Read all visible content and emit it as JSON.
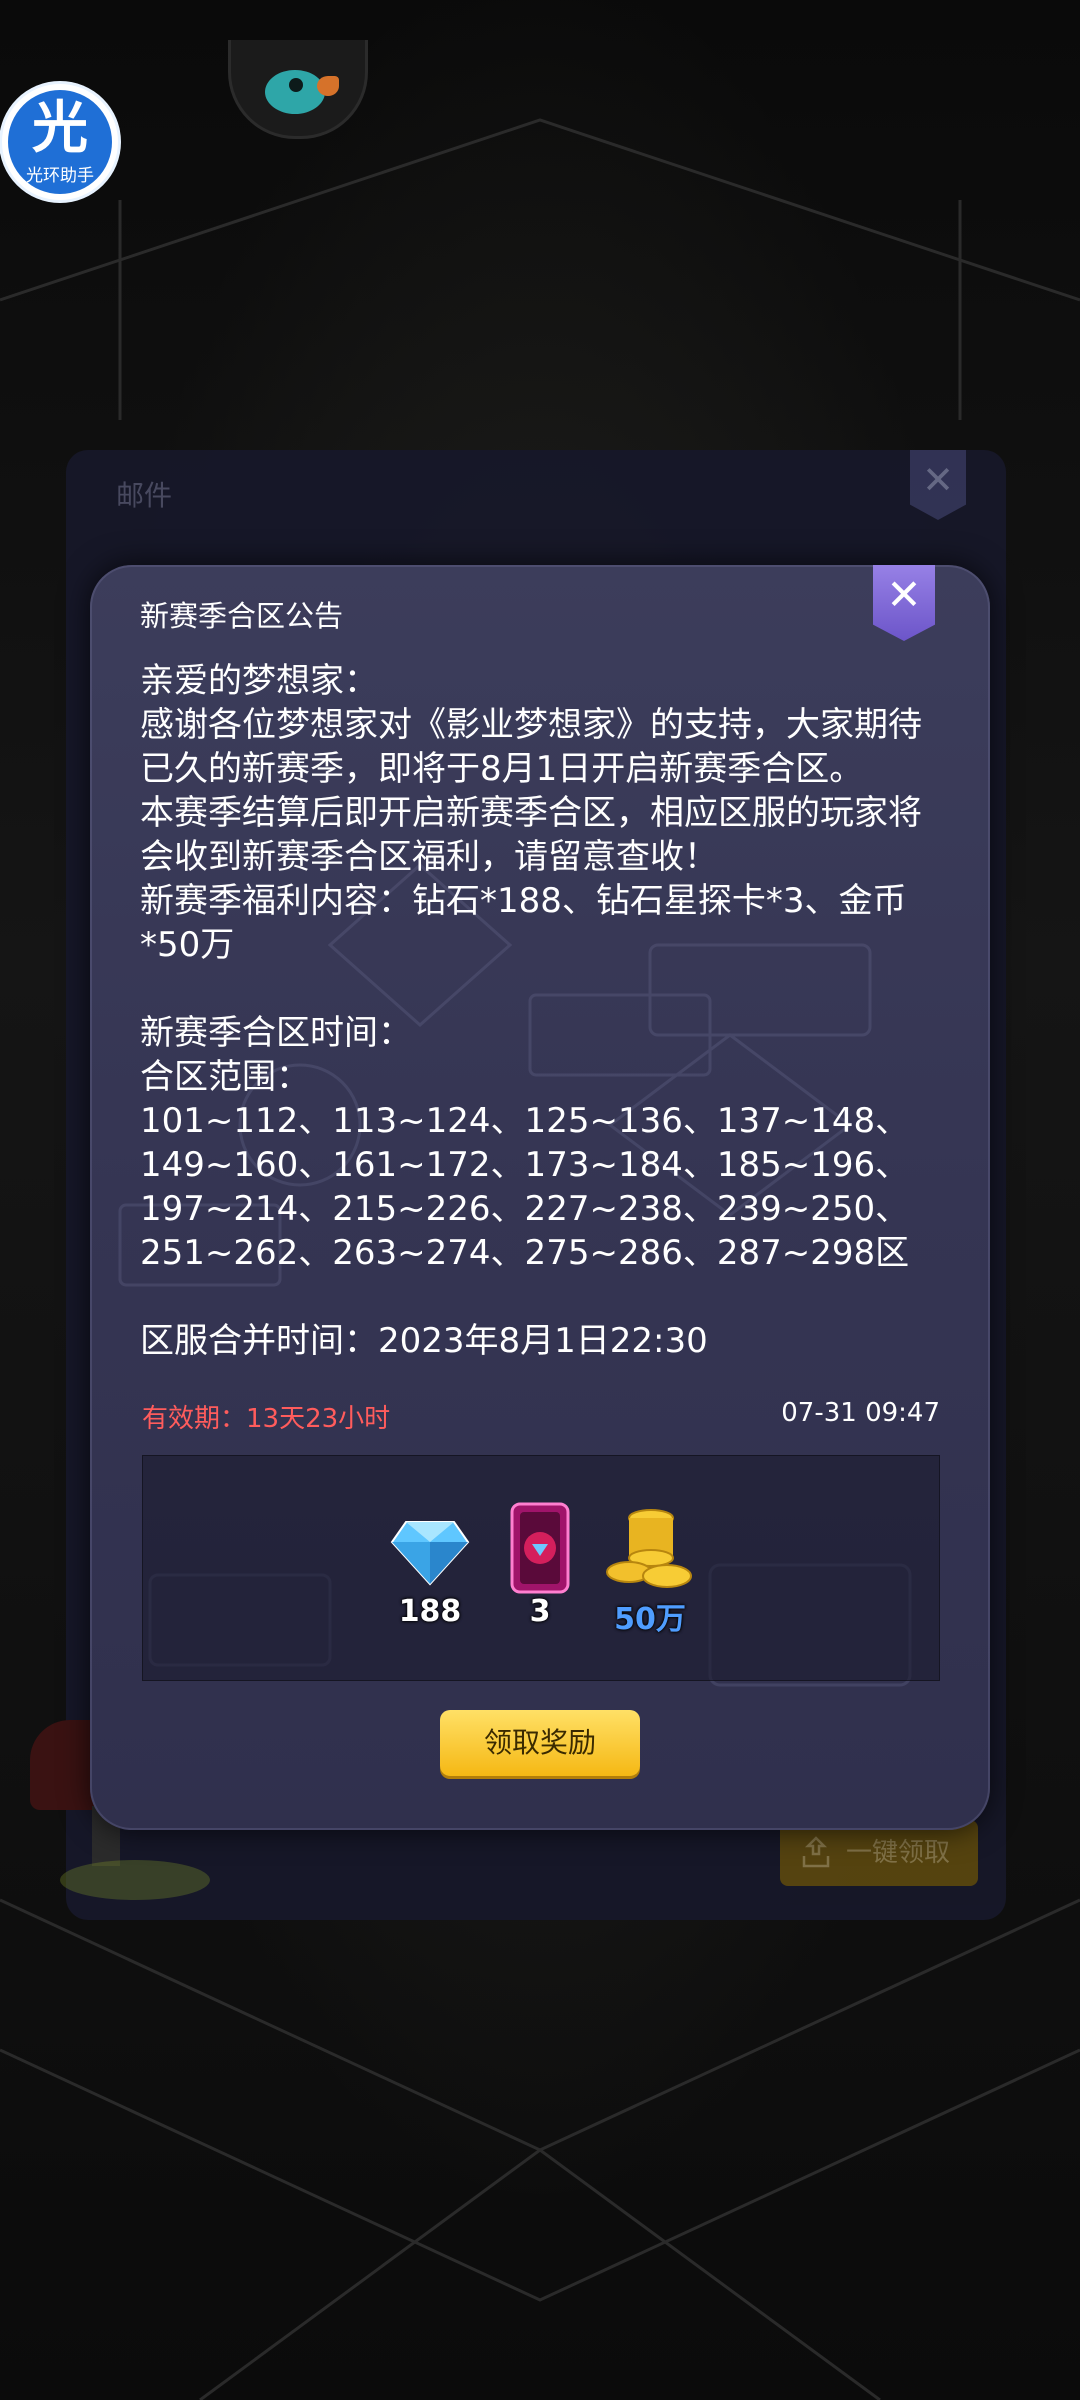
{
  "assistant": {
    "glyph": "光",
    "label": "光环助手"
  },
  "mail_panel": {
    "title": "邮件",
    "claim_all_label": "一键领取"
  },
  "dialog": {
    "title": "新赛季合区公告",
    "body": "亲爱的梦想家：\n感谢各位梦想家对《影业梦想家》的支持，大家期待已久的新赛季，即将于8月1日开启新赛季合区。\n本赛季结算后即开启新赛季合区，相应区服的玩家将会收到新赛季合区福利，请留意查收！\n新赛季福利内容：钻石*188、钻石星探卡*3、金币*50万\n\n新赛季合区时间：\n合区范围：\n101~112、113~124、125~136、137~148、149~160、161~172、173~184、185~196、197~214、215~226、227~238、239~250、251~262、263~274、275~286、287~298区\n\n区服合并时间：2023年8月1日22:30",
    "validity": "有效期：13天23小时",
    "timestamp": "07-31 09:47",
    "rewards": [
      {
        "icon": "diamond-icon",
        "quantity": "188"
      },
      {
        "icon": "scout-card-icon",
        "quantity": "3"
      },
      {
        "icon": "gold-coins-icon",
        "quantity": "50万"
      }
    ],
    "claim_label": "领取奖励"
  },
  "colors": {
    "validity": "#ff5c5c",
    "claim_button": "#f5b814",
    "close_button": "#7a62d6"
  }
}
